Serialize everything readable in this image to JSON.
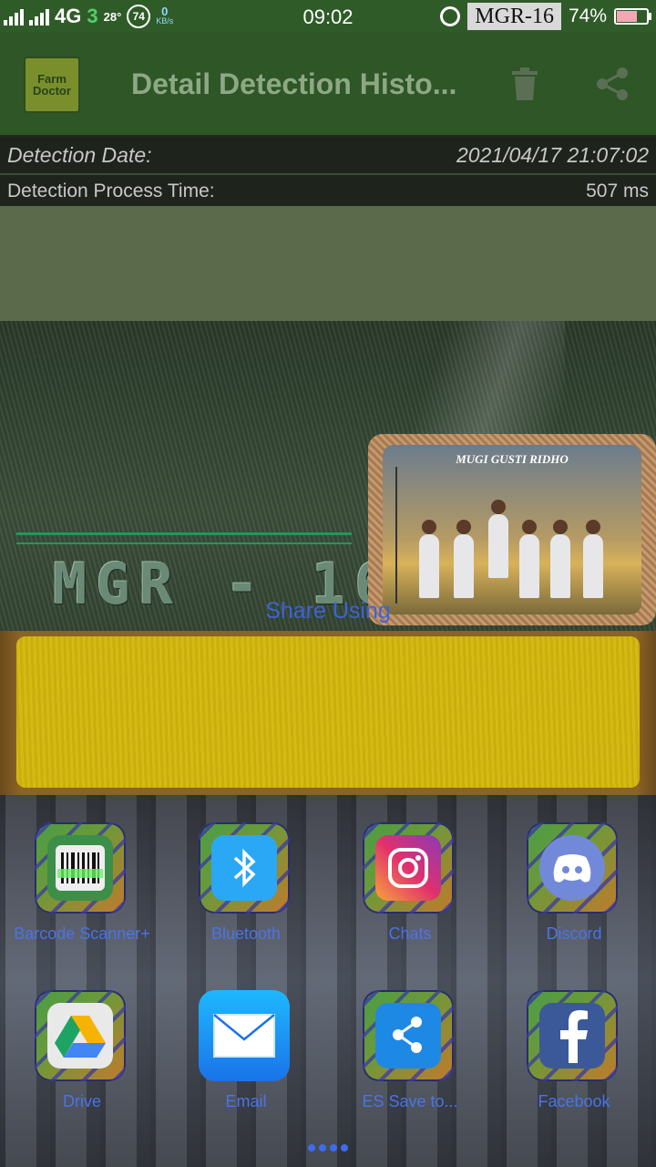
{
  "status_bar": {
    "network": "4G",
    "carrier_digit": "3",
    "temperature": "28°",
    "notification_count": "74",
    "speed_value": "0",
    "speed_unit": "KB/s",
    "time": "09:02",
    "carrier": "MGR-16",
    "battery": "74%",
    "battery_level": 0.74
  },
  "app_bar": {
    "logo_line1": "Farm",
    "logo_line2": "Doctor",
    "title": "Detail Detection Histo..."
  },
  "details": {
    "date_label": "Detection Date:",
    "date_value": "2021/04/17 21:07:02",
    "process_label": "Detection Process Time:",
    "process_value": "507 ms"
  },
  "wallpaper": {
    "logo_text": "MGR - 16",
    "photo_caption": "MUGI GUSTI RIDHO"
  },
  "share_sheet": {
    "title": "Share Using",
    "apps": [
      {
        "label": "Barcode Scanner+",
        "icon": "barcode-icon"
      },
      {
        "label": "Bluetooth",
        "icon": "bluetooth-icon"
      },
      {
        "label": "Chats",
        "icon": "instagram-icon"
      },
      {
        "label": "Discord",
        "icon": "discord-icon"
      },
      {
        "label": "Drive",
        "icon": "drive-icon"
      },
      {
        "label": "Email",
        "icon": "email-icon"
      },
      {
        "label": "ES Save to...",
        "icon": "es-file-icon"
      },
      {
        "label": "Facebook",
        "icon": "facebook-icon"
      }
    ],
    "page_count": 4
  }
}
